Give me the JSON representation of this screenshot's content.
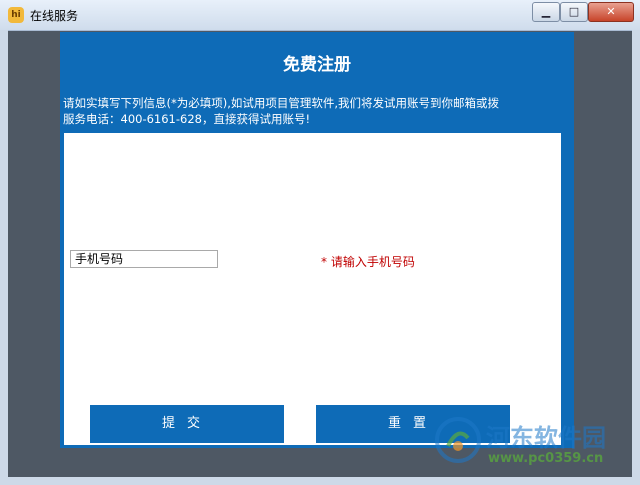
{
  "window": {
    "title": "在线服务",
    "app_icon_text": "hi",
    "controls": {
      "minimize": "▁",
      "maximize": "□",
      "close": "✕"
    }
  },
  "form": {
    "title": "免费注册",
    "intro_line1": "请如实填写下列信息(*为必填项),如试用项目管理软件,我们将发试用账号到你邮箱或拨",
    "intro_line2": "服务电话：400-6161-628，直接获得试用账号!",
    "phone_field": {
      "value": "",
      "placeholder": "手机号码"
    },
    "phone_hint": "* 请输入手机号码",
    "submit_label": "提交",
    "reset_label": "重置"
  },
  "watermark": {
    "text": "河东软件园",
    "url": "www.pc0359.cn"
  },
  "colors": {
    "panel_blue": "#0e6bb7",
    "hint_red": "#c00000",
    "client_gray": "#4e5864"
  }
}
